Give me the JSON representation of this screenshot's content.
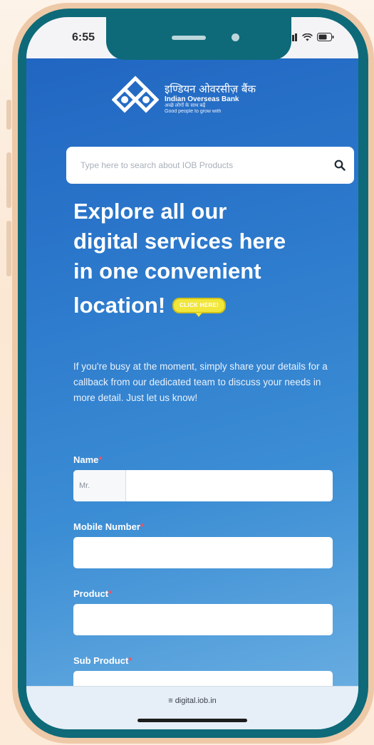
{
  "status_bar": {
    "time": "6:55"
  },
  "logo": {
    "hindi_name": "इण्डियन ओवरसीज़ बैंक",
    "english_name": "Indian Overseas Bank",
    "tagline_hindi": "अच्छे लोगों के साथ बढ़ें",
    "tagline_english": "Good people to grow with"
  },
  "search": {
    "placeholder": "Type here to search about IOB Products"
  },
  "headline": {
    "line1": "Explore all our",
    "line2": "digital services here",
    "line3": "in one convenient",
    "line4": "location!",
    "badge": "CLICK HERE!"
  },
  "intro_text": "If you're busy at the moment, simply share your details for a callback from our dedicated team to discuss your needs in more detail. Just let us know!",
  "form": {
    "name_label": "Name",
    "salutation_value": "Mr.",
    "mobile_label": "Mobile Number",
    "product_label": "Product",
    "sub_product_label": "Sub Product",
    "required_mark": "*"
  },
  "browser": {
    "url": "digital.iob.in"
  },
  "colors": {
    "bezel": "#0e6a78",
    "screen_gradient_start": "#1f63c0",
    "screen_gradient_end": "#6fb2e3",
    "required": "#ff4d5a",
    "badge": "#f1e63a"
  }
}
